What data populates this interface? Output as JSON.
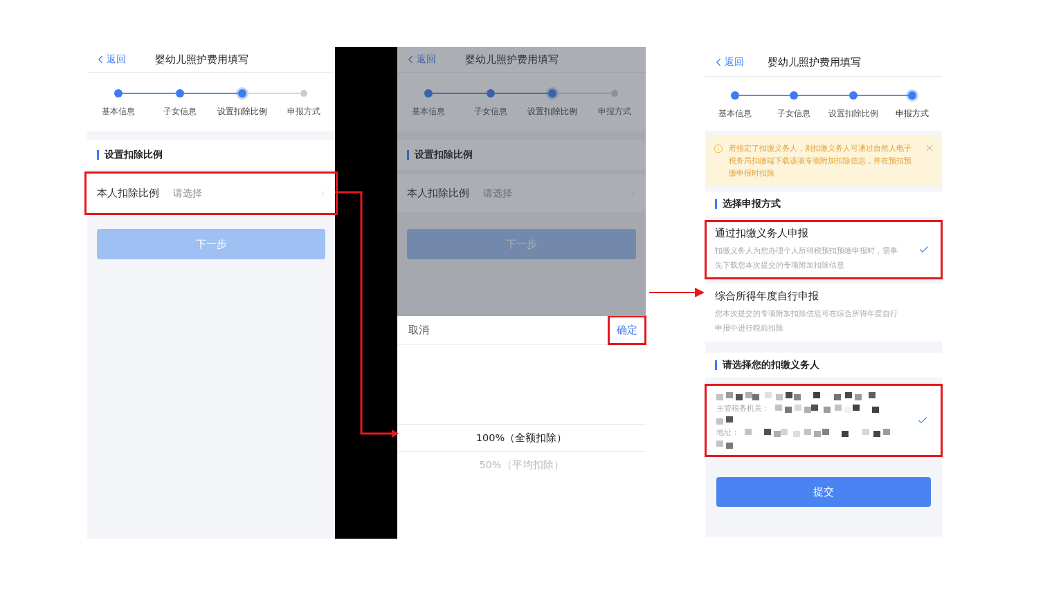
{
  "screens": [
    {
      "kind": "deduction_form",
      "dimmed": false,
      "header": {
        "back": "返回",
        "title": "婴幼儿照护费用填写"
      },
      "steps": [
        {
          "label": "基本信息",
          "done": true,
          "selected": false
        },
        {
          "label": "子女信息",
          "done": true,
          "selected": false
        },
        {
          "label": "设置扣除比例",
          "done": false,
          "selected": true
        },
        {
          "label": "申报方式",
          "done": false,
          "selected": false
        }
      ],
      "section_title": "设置扣除比例",
      "field": {
        "label": "本人扣除比例",
        "placeholder": "请选择",
        "highlighted": true
      },
      "next_button": {
        "label": "下一步",
        "disabled": true
      }
    },
    {
      "kind": "deduction_form",
      "dimmed": true,
      "header": {
        "back": "返回",
        "title": "婴幼儿照护费用填写"
      },
      "steps": [
        {
          "label": "基本信息",
          "done": true,
          "selected": false
        },
        {
          "label": "子女信息",
          "done": true,
          "selected": false
        },
        {
          "label": "设置扣除比例",
          "done": false,
          "selected": true
        },
        {
          "label": "申报方式",
          "done": false,
          "selected": false
        }
      ],
      "section_title": "设置扣除比例",
      "field": {
        "label": "本人扣除比例",
        "placeholder": "请选择"
      },
      "next_button": {
        "label": "下一步",
        "disabled": true
      },
      "picker": {
        "cancel": "取消",
        "confirm": "确定",
        "confirm_highlighted": true,
        "options": [
          {
            "label": "100%（全额扣除）",
            "selected": true
          },
          {
            "label": "50%（平均扣除）",
            "selected": false
          }
        ]
      }
    },
    {
      "kind": "filing_method",
      "header": {
        "back": "返回",
        "title": "婴幼儿照护费用填写"
      },
      "steps": [
        {
          "label": "基本信息",
          "done": true,
          "selected": false
        },
        {
          "label": "子女信息",
          "done": true,
          "selected": false
        },
        {
          "label": "设置扣除比例",
          "done": true,
          "selected": false
        },
        {
          "label": "申报方式",
          "done": false,
          "selected": true
        }
      ],
      "notice": "若指定了扣缴义务人，则扣缴义务人可通过自然人电子税务局扣缴端下载该项专项附加扣除信息，并在预扣预缴申报时扣除",
      "method_section_title": "选择申报方式",
      "methods": [
        {
          "title": "通过扣缴义务人申报",
          "description": "扣缴义务人为您办理个人所得税预扣预缴申报时，需事先下载您本次提交的专项附加扣除信息",
          "selected": true,
          "highlighted": true
        },
        {
          "title": "综合所得年度自行申报",
          "description": "您本次提交的专项附加扣除信息可在综合所得年度自行申报中进行税前扣除",
          "selected": false,
          "highlighted": false
        }
      ],
      "payer_section_title": "请选择您的扣缴义务人",
      "payer": {
        "authority_label": "主管税务机关：",
        "address_label": "地址：",
        "selected": true,
        "highlighted": true
      },
      "submit_button": {
        "label": "提交",
        "disabled": false
      }
    }
  ]
}
